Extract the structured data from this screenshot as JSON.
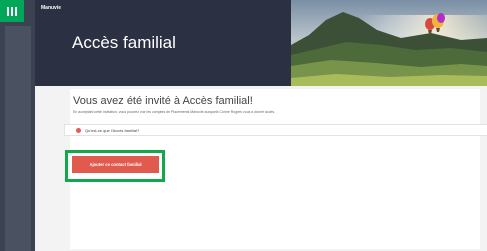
{
  "header": {
    "brand": "Manuvie",
    "page_title": "Accès familial"
  },
  "invite": {
    "title": "Vous avez été invité à Accès familial!",
    "description": "En acceptant cette invitation, vous pourrez voir les comptes de Placements Manuvie auxquels Corine Rogers vous a donné accès."
  },
  "faq": {
    "label": "Qu'est-ce que l'Accès familial?"
  },
  "actions": {
    "add_contact_label": "Ajouter ce contact familial"
  },
  "colors": {
    "accent_green": "#00a758",
    "button_red": "#e05b4e",
    "highlight_green": "#12a74a",
    "dark_nav": "#2b3042"
  },
  "icons": {
    "logo": "manulife-bars-logo",
    "faq": "info-circle-icon"
  }
}
